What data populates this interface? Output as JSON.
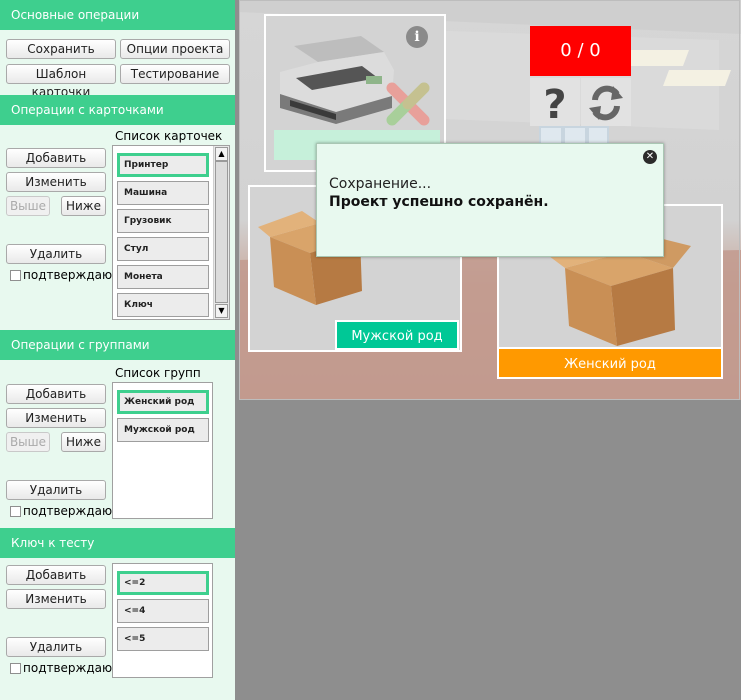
{
  "colors": {
    "accent": "#3ecf8e",
    "sidebar_bg": "#e8f9ef",
    "score_bg": "#ff0000",
    "female_label": "#ff9900",
    "male_label": "#00c896"
  },
  "basic": {
    "header": "Основные операции",
    "save": "Сохранить",
    "options": "Опции проекта",
    "template": "Шаблон карточки",
    "testing": "Тестирование"
  },
  "cards": {
    "header": "Операции с карточками",
    "add": "Добавить",
    "edit": "Изменить",
    "up": "Выше",
    "down": "Ниже",
    "delete": "Удалить",
    "confirm": "подтверждаю",
    "list_title": "Список карточек",
    "items": [
      "Принтер",
      "Машина",
      "Грузовик",
      "Стул",
      "Монета",
      "Ключ"
    ]
  },
  "groups": {
    "header": "Операции с группами",
    "add": "Добавить",
    "edit": "Изменить",
    "up": "Выше",
    "down": "Ниже",
    "delete": "Удалить",
    "confirm": "подтверждаю",
    "list_title": "Список групп",
    "items": [
      "Женский род",
      "Мужской род"
    ]
  },
  "key": {
    "header": "Ключ к тесту",
    "add": "Добавить",
    "edit": "Изменить",
    "delete": "Удалить",
    "confirm": "подтверждаю",
    "items": [
      "<=2",
      "<=4",
      "<=5"
    ]
  },
  "stage": {
    "score": "0 / 0",
    "male_label": "Мужской род",
    "female_label": "Женский род",
    "icons": [
      "info-icon",
      "wrong-cross-icon",
      "help-icon",
      "refresh-icon",
      "close-icon"
    ]
  },
  "modal": {
    "line1": "Сохранение...",
    "line2": "Проект успешно сохранён."
  }
}
